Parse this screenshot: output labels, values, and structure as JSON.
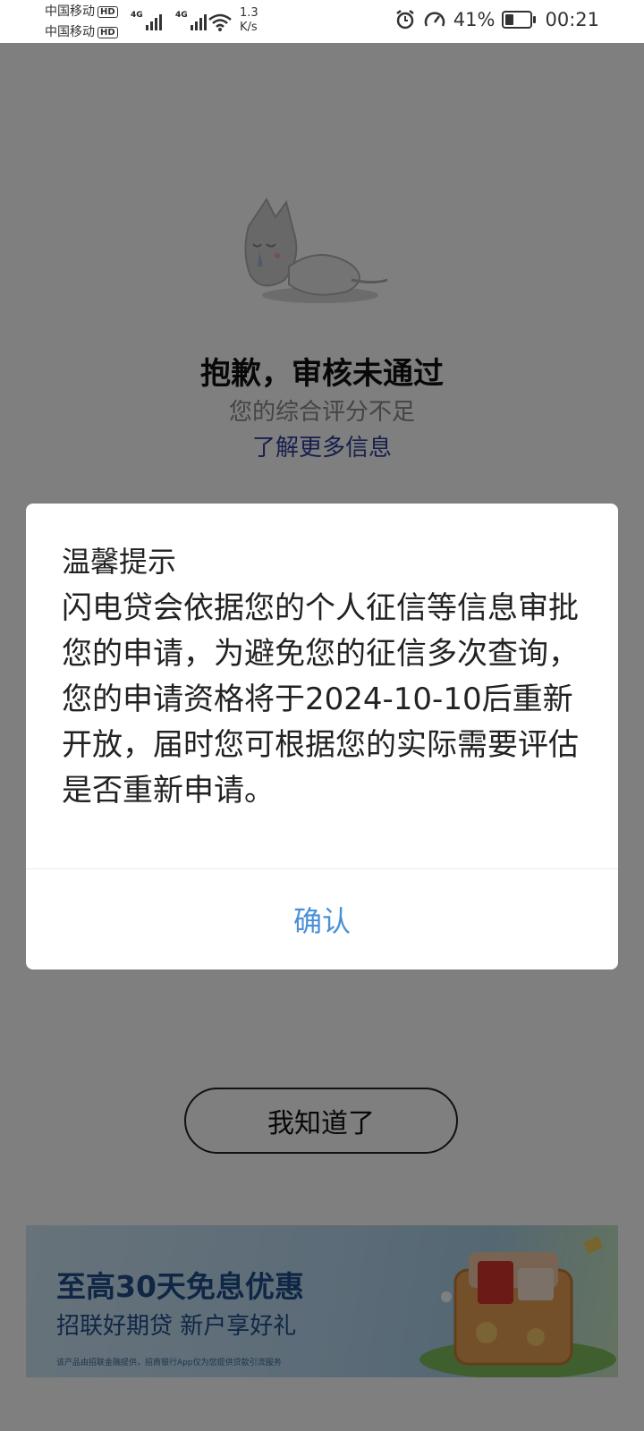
{
  "status_bar": {
    "carrier_1": "中国移动",
    "carrier_2": "中国移动",
    "hd_badge": "HD",
    "net_type_1": "4G",
    "net_type_2": "4G",
    "net_speed_value": "1.3",
    "net_speed_unit": "K/s",
    "battery_percent": "41%",
    "battery_level": 0.41,
    "time": "00:21",
    "icons": [
      "alarm-icon",
      "speed-icon",
      "battery-icon",
      "wifi-icon",
      "signal-icon"
    ]
  },
  "result": {
    "title": "抱歉，审核未通过",
    "subtitle": "您的综合评分不足",
    "link": "了解更多信息"
  },
  "dialog": {
    "title": "温馨提示",
    "body": "闪电贷会依据您的个人征信等信息审批您的申请，为避免您的征信多次查询，您的申请资格将于2024-10-10后重新开放，届时您可根据您的实际需要评估是否重新申请。",
    "confirm_label": "确认"
  },
  "main_button_label": "我知道了",
  "banner": {
    "title": "至高30天免息优惠",
    "subtitle": "招联好期贷 新户享好礼",
    "note": "该产品由招联金融提供，招商银行App仅为您提供贷款引流服务"
  },
  "colors": {
    "overlay": "rgba(0,0,0,0.5)",
    "link": "#2f3e9c",
    "confirm": "#4a90d9",
    "banner_text": "#1f4e8a"
  }
}
